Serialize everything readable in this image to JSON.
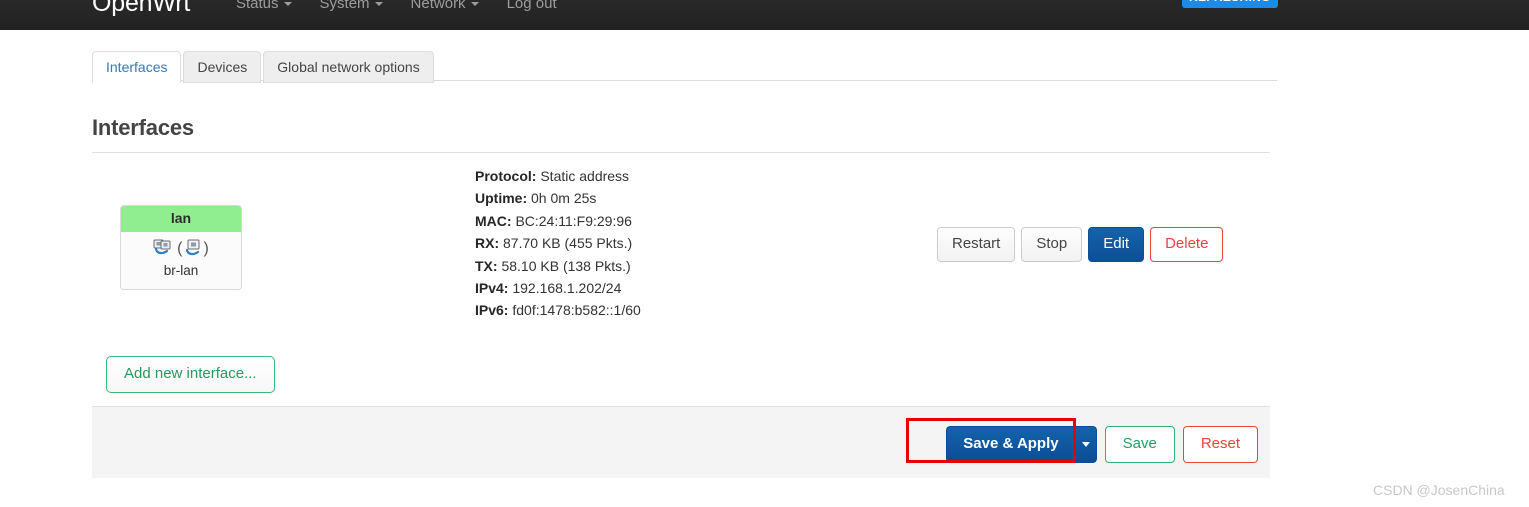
{
  "navbar": {
    "brand": "OpenWrt",
    "menu": [
      {
        "label": "Status",
        "caret": true
      },
      {
        "label": "System",
        "caret": true
      },
      {
        "label": "Network",
        "caret": true
      },
      {
        "label": "Log out",
        "caret": false
      }
    ],
    "status_badge": "REFRESHING",
    "badge_color": "#1e8ae8"
  },
  "tabs": [
    {
      "label": "Interfaces",
      "active": true
    },
    {
      "label": "Devices",
      "active": false
    },
    {
      "label": "Global network options",
      "active": false
    }
  ],
  "page": {
    "title": "Interfaces"
  },
  "interface": {
    "name": "lan",
    "device": "br-lan",
    "icon_left": "ethernet-ports-icon",
    "icon_right": "ethernet-device-icon",
    "header_color": "#90ee90",
    "details": [
      {
        "key": "Protocol:",
        "value": "Static address"
      },
      {
        "key": "Uptime:",
        "value": "0h 0m 25s"
      },
      {
        "key": "MAC:",
        "value": "BC:24:11:F9:29:96"
      },
      {
        "key": "RX:",
        "value": "87.70 KB (455 Pkts.)"
      },
      {
        "key": "TX:",
        "value": "58.10 KB (138 Pkts.)"
      },
      {
        "key": "IPv4:",
        "value": "192.168.1.202/24"
      },
      {
        "key": "IPv6:",
        "value": "fd0f:1478:b582::1/60"
      }
    ],
    "actions": {
      "restart": "Restart",
      "stop": "Stop",
      "edit": "Edit",
      "delete": "Delete"
    }
  },
  "add_interface_label": "Add new interface...",
  "footer": {
    "save_apply": "Save & Apply",
    "dropdown_icon": "caret-down-icon",
    "save": "Save",
    "reset": "Reset",
    "highlight_color": "#e60000"
  },
  "watermark": "CSDN @JosenChina"
}
